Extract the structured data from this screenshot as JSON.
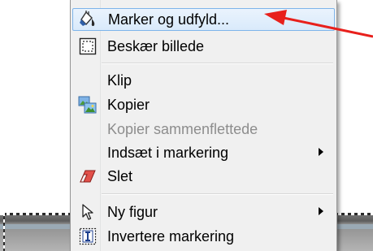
{
  "menu": {
    "items": [
      {
        "label": "Marker og udfyld...",
        "icon": "select-fill-icon",
        "highlighted": true,
        "disabled": false,
        "submenu": false
      },
      {
        "label": "Beskær billede",
        "icon": "crop-icon",
        "highlighted": false,
        "disabled": false,
        "submenu": false
      },
      {
        "label": "Klip",
        "icon": "",
        "highlighted": false,
        "disabled": false,
        "submenu": false
      },
      {
        "label": "Kopier",
        "icon": "copy-image-icon",
        "highlighted": false,
        "disabled": false,
        "submenu": false
      },
      {
        "label": "Kopier sammenflettede",
        "icon": "",
        "highlighted": false,
        "disabled": true,
        "submenu": false
      },
      {
        "label": "Indsæt i markering",
        "icon": "",
        "highlighted": false,
        "disabled": false,
        "submenu": true
      },
      {
        "label": "Slet",
        "icon": "eraser-icon",
        "highlighted": false,
        "disabled": false,
        "submenu": false
      },
      {
        "label": "Ny figur",
        "icon": "pointer-icon",
        "highlighted": false,
        "disabled": false,
        "submenu": true
      },
      {
        "label": "Invertere markering",
        "icon": "invert-selection-icon",
        "highlighted": false,
        "disabled": false,
        "submenu": false
      }
    ]
  },
  "colors": {
    "highlight_border": "#7eb4ea",
    "disabled_text": "#8d8d8d",
    "annotation_arrow": "#e8201c"
  }
}
